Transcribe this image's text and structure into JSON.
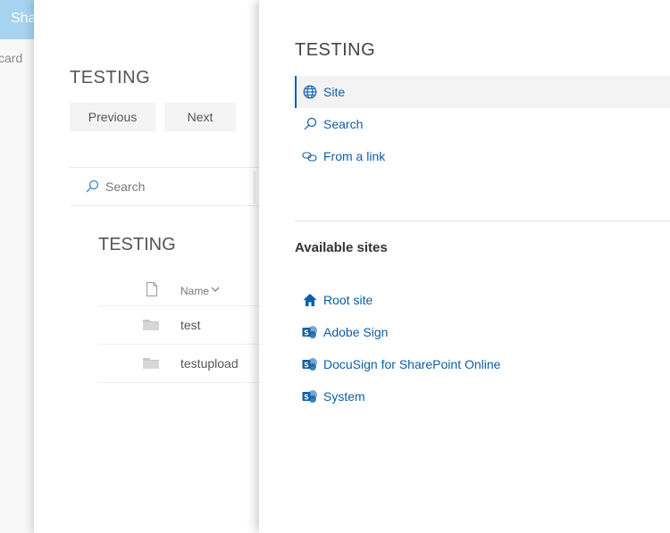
{
  "background": {
    "header_text": "SharePoint",
    "card_text": "card"
  },
  "middle_panel": {
    "title": "TESTING",
    "previous_label": "Previous",
    "next_label": "Next",
    "search_placeholder": "Search",
    "library_title": "TESTING",
    "column_name": "Name",
    "rows": [
      {
        "name": "test",
        "icon": "folder-icon"
      },
      {
        "name": "testupload",
        "icon": "folder-icon"
      }
    ]
  },
  "right_panel": {
    "title": "TESTING",
    "nav": [
      {
        "label": "Site",
        "icon": "globe-icon",
        "selected": true
      },
      {
        "label": "Search",
        "icon": "search-icon",
        "selected": false
      },
      {
        "label": "From a link",
        "icon": "link-icon",
        "selected": false
      }
    ],
    "available_heading": "Available sites",
    "sites": [
      {
        "label": "Root site",
        "icon": "home-icon"
      },
      {
        "label": "Adobe Sign",
        "icon": "sharepoint-icon"
      },
      {
        "label": "DocuSign for SharePoint Online",
        "icon": "sharepoint-icon"
      },
      {
        "label": "System",
        "icon": "sharepoint-icon"
      }
    ]
  },
  "colors": {
    "accent": "#0a5fa8",
    "header_bg": "#a6d3f0"
  }
}
